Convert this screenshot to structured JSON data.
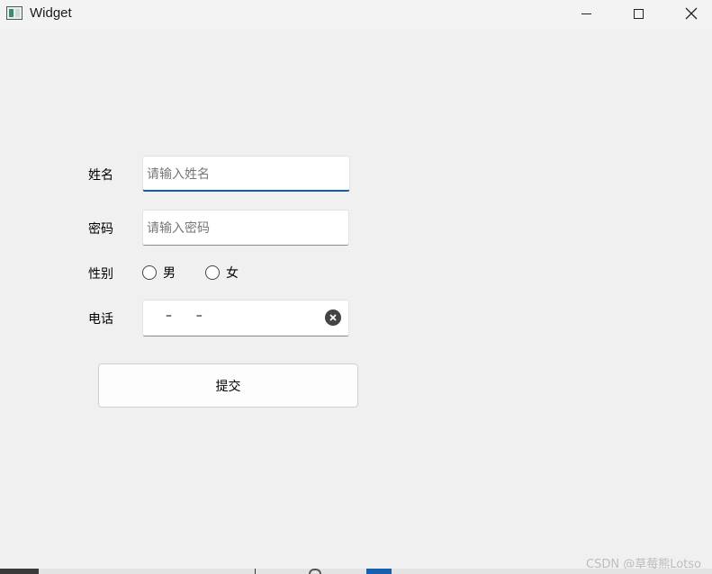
{
  "window": {
    "title": "Widget"
  },
  "form": {
    "name": {
      "label": "姓名",
      "placeholder": "请输入姓名"
    },
    "password": {
      "label": "密码",
      "placeholder": "请输入密码"
    },
    "gender": {
      "label": "性别",
      "options": [
        "男",
        "女"
      ]
    },
    "phone": {
      "label": "电话",
      "mask": "–      –"
    },
    "submit_label": "提交"
  },
  "watermark": "CSDN @草莓熊Lotso",
  "icons": {
    "app": "app-window-icon",
    "minimize": "minimize-icon",
    "maximize": "maximize-icon",
    "close": "close-icon",
    "clear": "clear-circle-icon"
  },
  "colors": {
    "focus_accent": "#0a5fb4",
    "background": "#f0f0f0"
  }
}
